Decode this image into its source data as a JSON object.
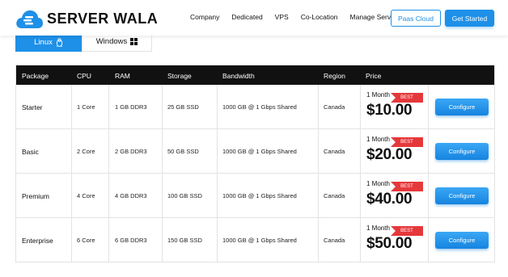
{
  "header": {
    "logo_text": "SERVER WALA",
    "nav": [
      "Company",
      "Dedicated",
      "VPS",
      "Co-Location",
      "Manage Services"
    ],
    "paas_label": "Paas Cloud",
    "cta_label": "Get Started",
    "accent": "#1e90e8"
  },
  "os_tabs": {
    "linux_label": "Linux",
    "linux_icon": "linux-icon",
    "windows_label": "Windows",
    "windows_icon": "windows-icon",
    "active": "Linux"
  },
  "table": {
    "headers": [
      "Package",
      "CPU",
      "RAM",
      "Storage",
      "Bandwidth",
      "Region",
      "Price"
    ],
    "rows": [
      {
        "package": "Starter",
        "cpu": "1 Core",
        "ram": "1 GB DDR3",
        "storage": "25 GB SSD",
        "bandwidth": "1000 GB @ 1 Gbps Shared",
        "region": "Canada",
        "period": "1 Month",
        "badge": "BEST",
        "price": "$10.00",
        "action": "Configure"
      },
      {
        "package": "Basic",
        "cpu": "2 Core",
        "ram": "2 GB DDR3",
        "storage": "50 GB SSD",
        "bandwidth": "1000 GB @ 1 Gbps Shared",
        "region": "Canada",
        "period": "1 Month",
        "badge": "BEST",
        "price": "$20.00",
        "action": "Configure"
      },
      {
        "package": "Premium",
        "cpu": "4 Core",
        "ram": "4 GB DDR3",
        "storage": "100 GB SSD",
        "bandwidth": "1000 GB @ 1 Gbps Shared",
        "region": "Canada",
        "period": "1 Month",
        "badge": "BEST",
        "price": "$40.00",
        "action": "Configure"
      },
      {
        "package": "Enterprise",
        "cpu": "6 Core",
        "ram": "6 GB DDR3",
        "storage": "150 GB SSD",
        "bandwidth": "1000 GB @ 1 Gbps Shared",
        "region": "Canada",
        "period": "1 Month",
        "badge": "BEST",
        "price": "$50.00",
        "action": "Configure"
      }
    ]
  }
}
